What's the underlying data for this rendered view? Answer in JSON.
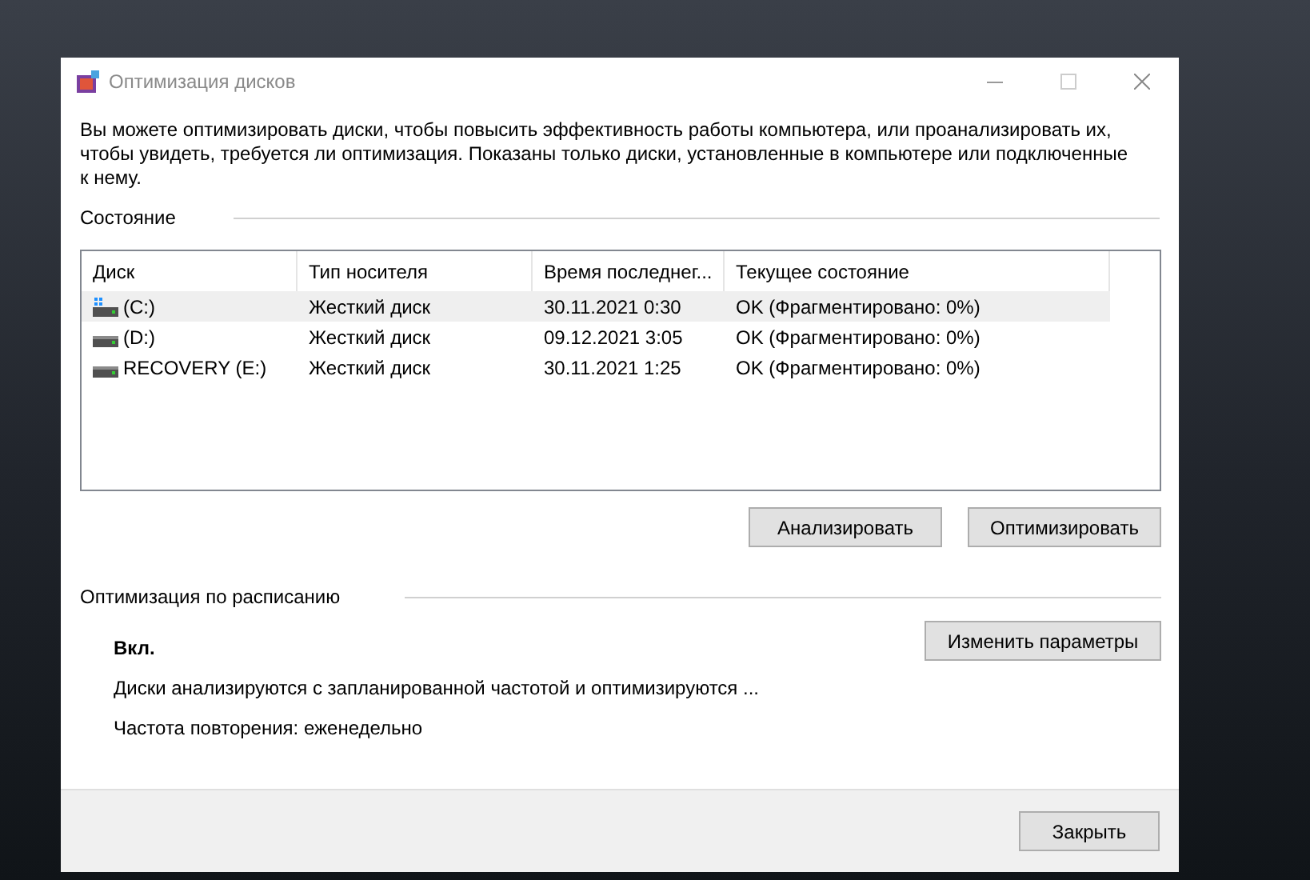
{
  "window": {
    "title": "Оптимизация дисков"
  },
  "description": "Вы можете оптимизировать диски, чтобы повысить эффективность работы  компьютера, или проанализировать их, чтобы увидеть, требуется ли оптимизация. Показаны только диски, установленные в компьютере или подключенные к нему.",
  "status_section": {
    "title": "Состояние"
  },
  "table": {
    "columns": [
      "Диск",
      "Тип носителя",
      "Время последнег...",
      "Текущее состояние"
    ],
    "rows": [
      {
        "kind": "system",
        "selected": true,
        "cells": [
          "(C:)",
          "Жесткий диск",
          "30.11.2021 0:30",
          "OK (Фрагментировано: 0%)"
        ]
      },
      {
        "kind": "plain",
        "selected": false,
        "cells": [
          "(D:)",
          "Жесткий диск",
          "09.12.2021 3:05",
          "OK (Фрагментировано: 0%)"
        ]
      },
      {
        "kind": "plain",
        "selected": false,
        "cells": [
          "RECOVERY (E:)",
          "Жесткий диск",
          "30.11.2021 1:25",
          "OK (Фрагментировано: 0%)"
        ]
      }
    ]
  },
  "actions": [
    "Анализировать",
    "Оптимизировать"
  ],
  "schedule": {
    "title": "Оптимизация по расписанию",
    "state": "Вкл.",
    "button": "Изменить параметры",
    "details": [
      "Диски анализируются с запланированной частотой и оптимизируются ...",
      "Частота повторения: еженедельно"
    ]
  },
  "footer": {
    "button": "Закрыть"
  }
}
